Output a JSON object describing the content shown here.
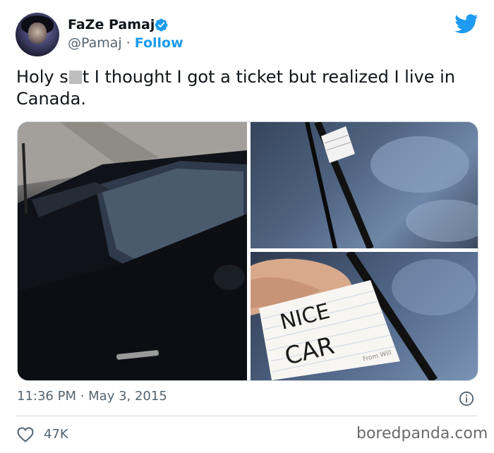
{
  "author": {
    "name": "FaZe Pamaj",
    "handle": "@Pamaj",
    "separator": "·",
    "follow_label": "Follow"
  },
  "tweet": {
    "text_part1": "Holy s",
    "text_part2": "t I thought I got a ticket but realized I live in Canada.",
    "timestamp": "11:36 PM · May 3, 2015",
    "likes": "47K"
  },
  "media": {
    "note_line1": "NICE",
    "note_line2": "CAR",
    "note_signature": "From Will"
  },
  "watermark": "boredpanda.com",
  "colors": {
    "accent": "#1d9bf0",
    "text": "#0f1419",
    "muted": "#536471"
  },
  "icons": {
    "verified": "verified-badge-icon",
    "brand": "twitter-bird-icon",
    "info": "info-icon",
    "like": "heart-icon"
  }
}
